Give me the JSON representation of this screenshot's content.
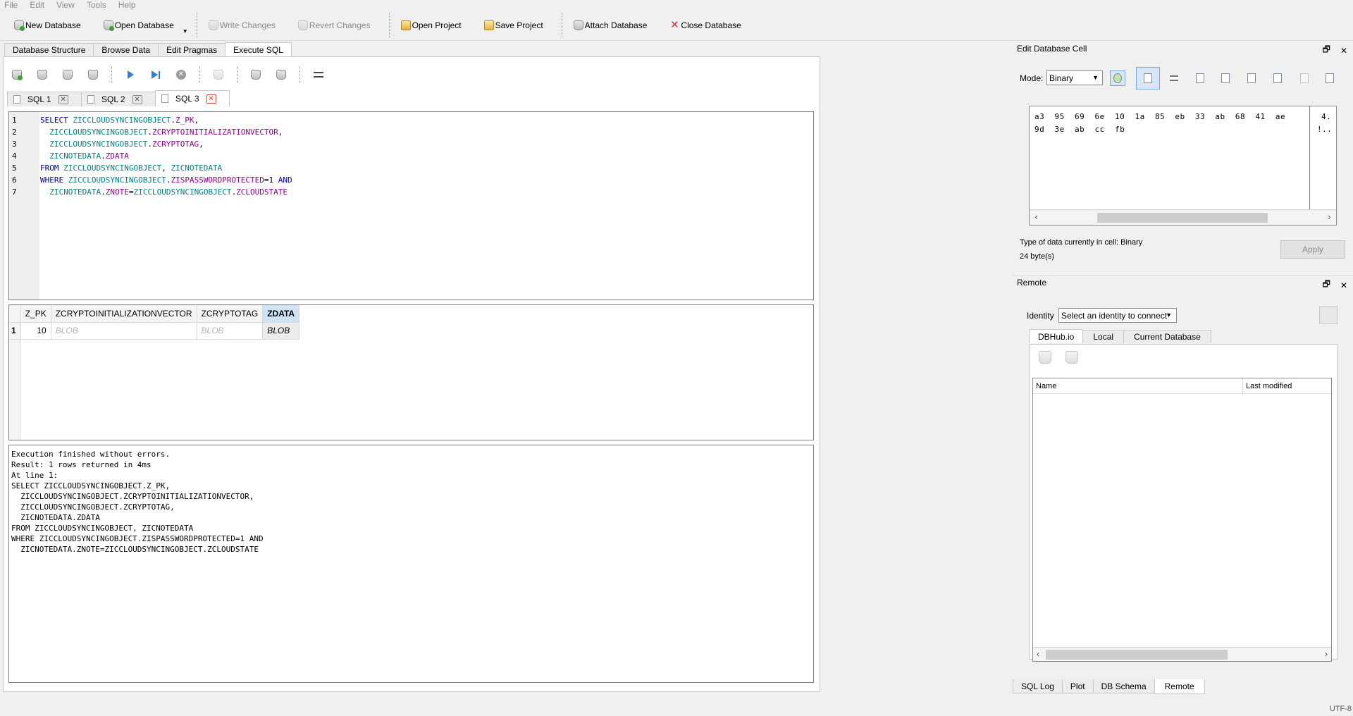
{
  "menu": [
    "File",
    "Edit",
    "View",
    "Tools",
    "Help"
  ],
  "toolbar": {
    "new_db": "New Database",
    "open_db": "Open Database",
    "write": "Write Changes",
    "revert": "Revert Changes",
    "open_project": "Open Project",
    "save_project": "Save Project",
    "attach_db": "Attach Database",
    "close_db": "Close Database"
  },
  "main_tabs": [
    "Database Structure",
    "Browse Data",
    "Edit Pragmas",
    "Execute SQL"
  ],
  "sql_tabs": [
    "SQL 1",
    "SQL 2",
    "SQL 3"
  ],
  "editor_lines": [
    {
      "num": "1",
      "parts": [
        [
          "kw",
          "SELECT "
        ],
        [
          "id",
          "ZICCLOUDSYNCINGOBJECT"
        ],
        [
          "txt",
          "."
        ],
        [
          "fld",
          "Z_PK"
        ],
        [
          "txt",
          ","
        ]
      ]
    },
    {
      "num": "2",
      "parts": [
        [
          "txt",
          "  "
        ],
        [
          "id",
          "ZICCLOUDSYNCINGOBJECT"
        ],
        [
          "txt",
          "."
        ],
        [
          "fld",
          "ZCRYPTOINITIALIZATIONVECTOR"
        ],
        [
          "txt",
          ","
        ]
      ]
    },
    {
      "num": "3",
      "parts": [
        [
          "txt",
          "  "
        ],
        [
          "id",
          "ZICCLOUDSYNCINGOBJECT"
        ],
        [
          "txt",
          "."
        ],
        [
          "fld",
          "ZCRYPTOTAG"
        ],
        [
          "txt",
          ","
        ]
      ]
    },
    {
      "num": "4",
      "parts": [
        [
          "txt",
          "  "
        ],
        [
          "id",
          "ZICNOTEDATA"
        ],
        [
          "txt",
          "."
        ],
        [
          "fld",
          "ZDATA"
        ]
      ]
    },
    {
      "num": "5",
      "parts": [
        [
          "kw",
          "FROM "
        ],
        [
          "id",
          "ZICCLOUDSYNCINGOBJECT"
        ],
        [
          "txt",
          ", "
        ],
        [
          "id",
          "ZICNOTEDATA"
        ]
      ]
    },
    {
      "num": "6",
      "parts": [
        [
          "kw",
          "WHERE "
        ],
        [
          "id",
          "ZICCLOUDSYNCINGOBJECT"
        ],
        [
          "txt",
          "."
        ],
        [
          "fld",
          "ZISPASSWORDPROTECTED"
        ],
        [
          "txt",
          "=1 "
        ],
        [
          "kw",
          "AND"
        ]
      ]
    },
    {
      "num": "7",
      "parts": [
        [
          "txt",
          "  "
        ],
        [
          "id",
          "ZICNOTEDATA"
        ],
        [
          "txt",
          "."
        ],
        [
          "fld",
          "ZNOTE"
        ],
        [
          "txt",
          "="
        ],
        [
          "id",
          "ZICCLOUDSYNCINGOBJECT"
        ],
        [
          "txt",
          "."
        ],
        [
          "fld",
          "ZCLOUDSTATE"
        ]
      ]
    }
  ],
  "results": {
    "columns": [
      "Z_PK",
      "ZCRYPTOINITIALIZATIONVECTOR",
      "ZCRYPTOTAG",
      "ZDATA"
    ],
    "rows": [
      {
        "num": "1",
        "cells": [
          "10",
          "BLOB",
          "BLOB",
          "BLOB"
        ]
      }
    ]
  },
  "message_lines": [
    "Execution finished without errors.",
    "Result: 1 rows returned in 4ms",
    "At line 1:",
    "SELECT ZICCLOUDSYNCINGOBJECT.Z_PK,",
    "  ZICCLOUDSYNCINGOBJECT.ZCRYPTOINITIALIZATIONVECTOR,",
    "  ZICCLOUDSYNCINGOBJECT.ZCRYPTOTAG,",
    "  ZICNOTEDATA.ZDATA",
    "FROM ZICCLOUDSYNCINGOBJECT, ZICNOTEDATA",
    "WHERE ZICCLOUDSYNCINGOBJECT.ZISPASSWORDPROTECTED=1 AND",
    "  ZICNOTEDATA.ZNOTE=ZICCLOUDSYNCINGOBJECT.ZCLOUDSTATE"
  ],
  "edit_cell": {
    "title": "Edit Database Cell",
    "mode_label": "Mode:",
    "mode_value": "Binary",
    "hex_rows": [
      "a3  95  69  6e  10  1a  85  eb  33  ab  68  41  ae",
      "9d  3e  ab  cc  fb"
    ],
    "ascii_rows": [
      "4.",
      "!.."
    ],
    "type_text": "Type of data currently in cell: Binary",
    "size_text": "24 byte(s)",
    "apply": "Apply"
  },
  "remote": {
    "title": "Remote",
    "identity_label": "Identity",
    "identity_value": "Select an identity to connect",
    "tabs": [
      "DBHub.io",
      "Local",
      "Current Database"
    ],
    "col_name": "Name",
    "col_modified": "Last modified"
  },
  "bottom_tabs": [
    "SQL Log",
    "Plot",
    "DB Schema",
    "Remote"
  ],
  "status": {
    "encoding": "UTF-8"
  },
  "dock_buttons": {
    "float": "🗗",
    "close": "✕"
  }
}
